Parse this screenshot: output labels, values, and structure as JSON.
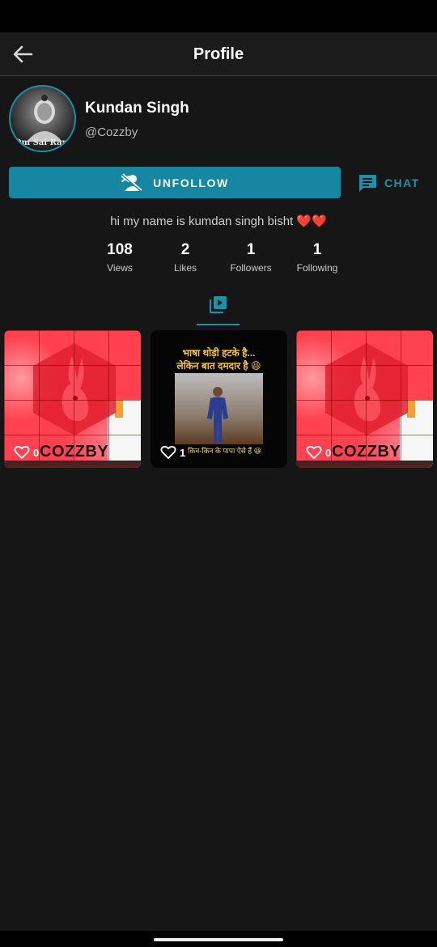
{
  "app_bar": {
    "title": "Profile",
    "back_icon": "arrow-back-icon"
  },
  "profile": {
    "avatar_caption": "Om Sai Ram",
    "name": "Kundan Singh",
    "handle": "@Cozzby",
    "bio_text": "hi my name is kumdan singh bisht",
    "bio_emoji": "❤️❤️"
  },
  "actions": {
    "unfollow_label": "UNFOLLOW",
    "unfollow_icon": "person-remove-icon",
    "chat_label": "CHAT",
    "chat_icon": "chat-bubble-icon"
  },
  "stats": [
    {
      "value": "108",
      "label": "Views"
    },
    {
      "value": "2",
      "label": "Likes"
    },
    {
      "value": "1",
      "label": "Followers"
    },
    {
      "value": "1",
      "label": "Following"
    }
  ],
  "tabs": {
    "active": "videos",
    "videos_icon": "video-library-icon"
  },
  "videos": [
    {
      "brand": "COZZBY",
      "likes": "0"
    },
    {
      "headline_line1": "भाषा थोड़ी हटके है...",
      "headline_line2": "लेकिन बात दमदार है 😆",
      "caption": "किन-किन के पापा ऐसे हैं 😆",
      "likes": "1"
    },
    {
      "brand": "COZZBY",
      "likes": "0"
    }
  ],
  "colors": {
    "background": "#161616",
    "accent": "#1587a3",
    "thumb_red": "#ff4150"
  }
}
